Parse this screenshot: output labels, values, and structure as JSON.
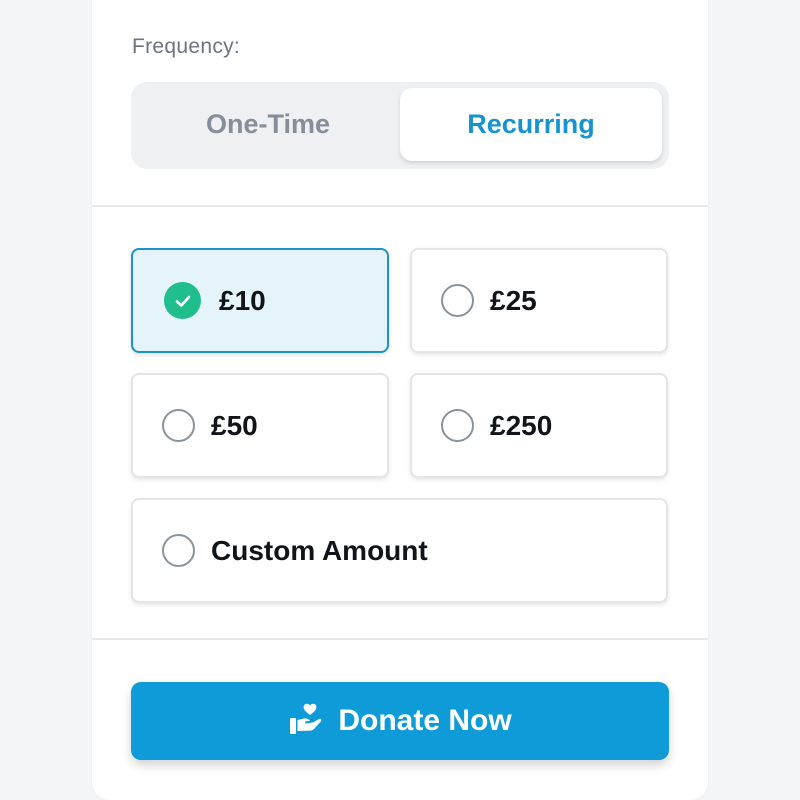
{
  "frequency": {
    "label": "Frequency:",
    "options": [
      "One-Time",
      "Recurring"
    ],
    "selected": "Recurring"
  },
  "amounts": {
    "options": [
      "£10",
      "£25",
      "£50",
      "£250",
      "Custom Amount"
    ],
    "selected": "£10"
  },
  "donate_button": {
    "label": "Donate Now",
    "icon": "hand-heart-icon"
  },
  "colors": {
    "accent": "#0f9bd7",
    "selected_border": "#2092cb",
    "selected_fill": "#e5f3fa",
    "check": "#1fbe8c"
  }
}
